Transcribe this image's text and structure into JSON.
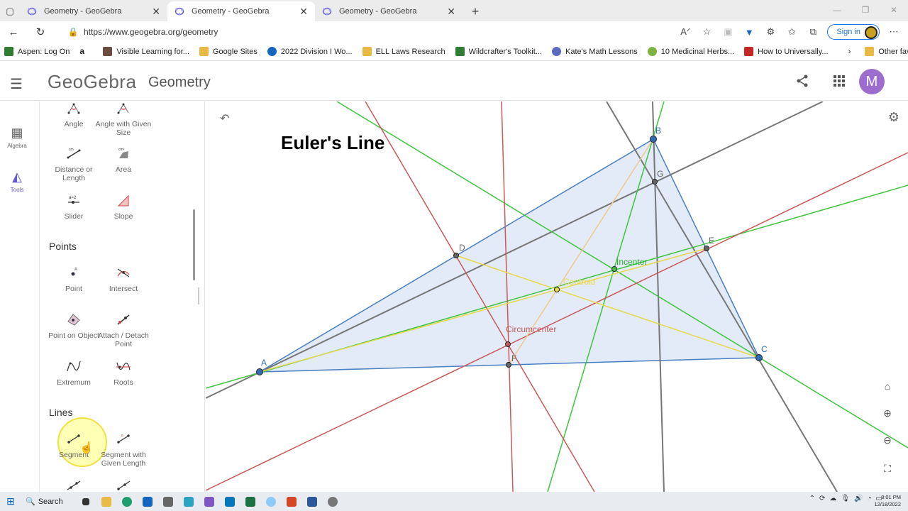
{
  "browser": {
    "tabs": [
      {
        "label": "Geometry - GeoGebra",
        "active": false
      },
      {
        "label": "Geometry - GeoGebra",
        "active": true
      },
      {
        "label": "Geometry - GeoGebra",
        "active": false
      }
    ],
    "url": "https://www.geogebra.org/geometry",
    "signin_label": "Sign in",
    "bookmarks": [
      {
        "label": "Aspen: Log On",
        "icon": "leaf-icon",
        "color": "#2e7d32"
      },
      {
        "label": "",
        "icon": "amazon-icon",
        "color": "#000000"
      },
      {
        "label": "Visible Learning for...",
        "icon": "figure-icon",
        "color": "#6d4c41"
      },
      {
        "label": "Google Sites",
        "icon": "folder-icon",
        "color": "#e9b943"
      },
      {
        "label": "2022 Division I Wo...",
        "icon": "ncaa-icon",
        "color": "#1565c0"
      },
      {
        "label": "ELL Laws Research",
        "icon": "folder-icon",
        "color": "#e9b943"
      },
      {
        "label": "Wildcrafter's Toolkit...",
        "icon": "book-icon",
        "color": "#2e7d32"
      },
      {
        "label": "Kate's Math Lessons",
        "icon": "globe-icon",
        "color": "#5c6bc0"
      },
      {
        "label": "10 Medicinal Herbs...",
        "icon": "herb-icon",
        "color": "#7cb342"
      },
      {
        "label": "How to Universally...",
        "icon": "page-icon",
        "color": "#c62828"
      }
    ],
    "other_favorites": "Other favorites"
  },
  "app": {
    "logo": "GeoGebra",
    "title": "Geometry",
    "user_initial": "M"
  },
  "rail": [
    {
      "label": "Algebra",
      "icon": "calculator-icon"
    },
    {
      "label": "Tools",
      "icon": "tools-icon"
    }
  ],
  "tools": {
    "measure": [
      {
        "label": "Angle",
        "icon": "angle-icon"
      },
      {
        "label": "Angle with Given Size",
        "icon": "angle-given-icon"
      },
      {
        "label": "Distance or Length",
        "icon": "distance-icon"
      },
      {
        "label": "Area",
        "icon": "area-icon"
      },
      {
        "label": "Slider",
        "icon": "slider-icon"
      },
      {
        "label": "Slope",
        "icon": "slope-icon"
      }
    ],
    "points_title": "Points",
    "points": [
      {
        "label": "Point",
        "icon": "point-icon"
      },
      {
        "label": "Intersect",
        "icon": "intersect-icon"
      },
      {
        "label": "Point on Object",
        "icon": "point-on-object-icon"
      },
      {
        "label": "Attach / Detach Point",
        "icon": "attach-icon"
      },
      {
        "label": "Extremum",
        "icon": "extremum-icon"
      },
      {
        "label": "Roots",
        "icon": "roots-icon"
      }
    ],
    "lines_title": "Lines",
    "lines": [
      {
        "label": "Segment",
        "icon": "segment-icon"
      },
      {
        "label": "Segment with Given Length",
        "icon": "segment-length-icon"
      }
    ]
  },
  "canvas": {
    "title_text": "Euler's Line",
    "labels": {
      "A": "A",
      "B": "B",
      "C": "C",
      "D": "D",
      "E": "E",
      "F": "F",
      "G": "G",
      "incenter": "Incenter",
      "centroid": "Centroid",
      "circumcenter": "Circumcenter"
    },
    "colors": {
      "triangle_fill": "#dbe6f5",
      "triangle_stroke": "#4a7fc1",
      "green": "#3ec43e",
      "red": "#c85a5a",
      "gray": "#777777",
      "yellow": "#e8d84a",
      "orange": "#e8b870"
    }
  },
  "taskbar": {
    "search_label": "Search",
    "time": "8:01 PM",
    "date": "12/18/2022"
  }
}
